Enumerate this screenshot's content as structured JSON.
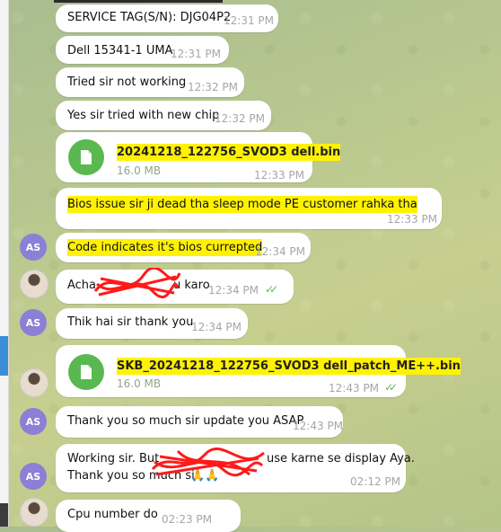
{
  "messages": [
    {
      "text": "SERVICE TAG(S/N): DJG04P2",
      "time": "12:31 PM"
    },
    {
      "text": "Dell 15341-1 UMA",
      "time": "12:31 PM"
    },
    {
      "text": "Tried sir not working",
      "time": "12:32 PM"
    },
    {
      "text": "Yes sir tried with new chip",
      "time": "12:32 PM"
    },
    {
      "file_name": "20241218_122756_SVOD3 dell.bin",
      "file_size": "16.0 MB",
      "time": "12:33 PM"
    },
    {
      "text": "Bios issue sir ji dead tha sleep mode PE customer rahka tha",
      "time": "12:33 PM"
    },
    {
      "avatar": "AS",
      "text": "Code indicates it's bios currepted",
      "time": "12:34 PM"
    },
    {
      "text_start": "Acha",
      "text_end": "u karo",
      "time": "12:34 PM"
    },
    {
      "avatar": "AS",
      "text": "Thik hai sir thank you",
      "time": "12:34 PM"
    },
    {
      "file_name": "SKB_20241218_122756_SVOD3 dell_patch_ME++.bin",
      "file_size": "16.0 MB",
      "time": "12:43 PM"
    },
    {
      "avatar": "AS",
      "text": "Thank you so much sir update you ASAP",
      "time": "12:43 PM"
    },
    {
      "avatar": "AS",
      "line1_start": "Working sir. But",
      "line1_end": "use karne se display Aya.",
      "line2": "Thank you so much sir",
      "emoji": "🙏🙏",
      "time": "02:12 PM"
    },
    {
      "text": "Cpu number do",
      "time": "02:23 PM"
    }
  ],
  "icons": {
    "file": "file-icon",
    "read_receipt": "double-check-icon"
  },
  "colors": {
    "highlight": "#fff200",
    "avatar_bg": "#8c7fd6",
    "file_icon_bg": "#59b84f",
    "read_tick": "#5fba4d",
    "left_accent": "#3a8fd6"
  }
}
